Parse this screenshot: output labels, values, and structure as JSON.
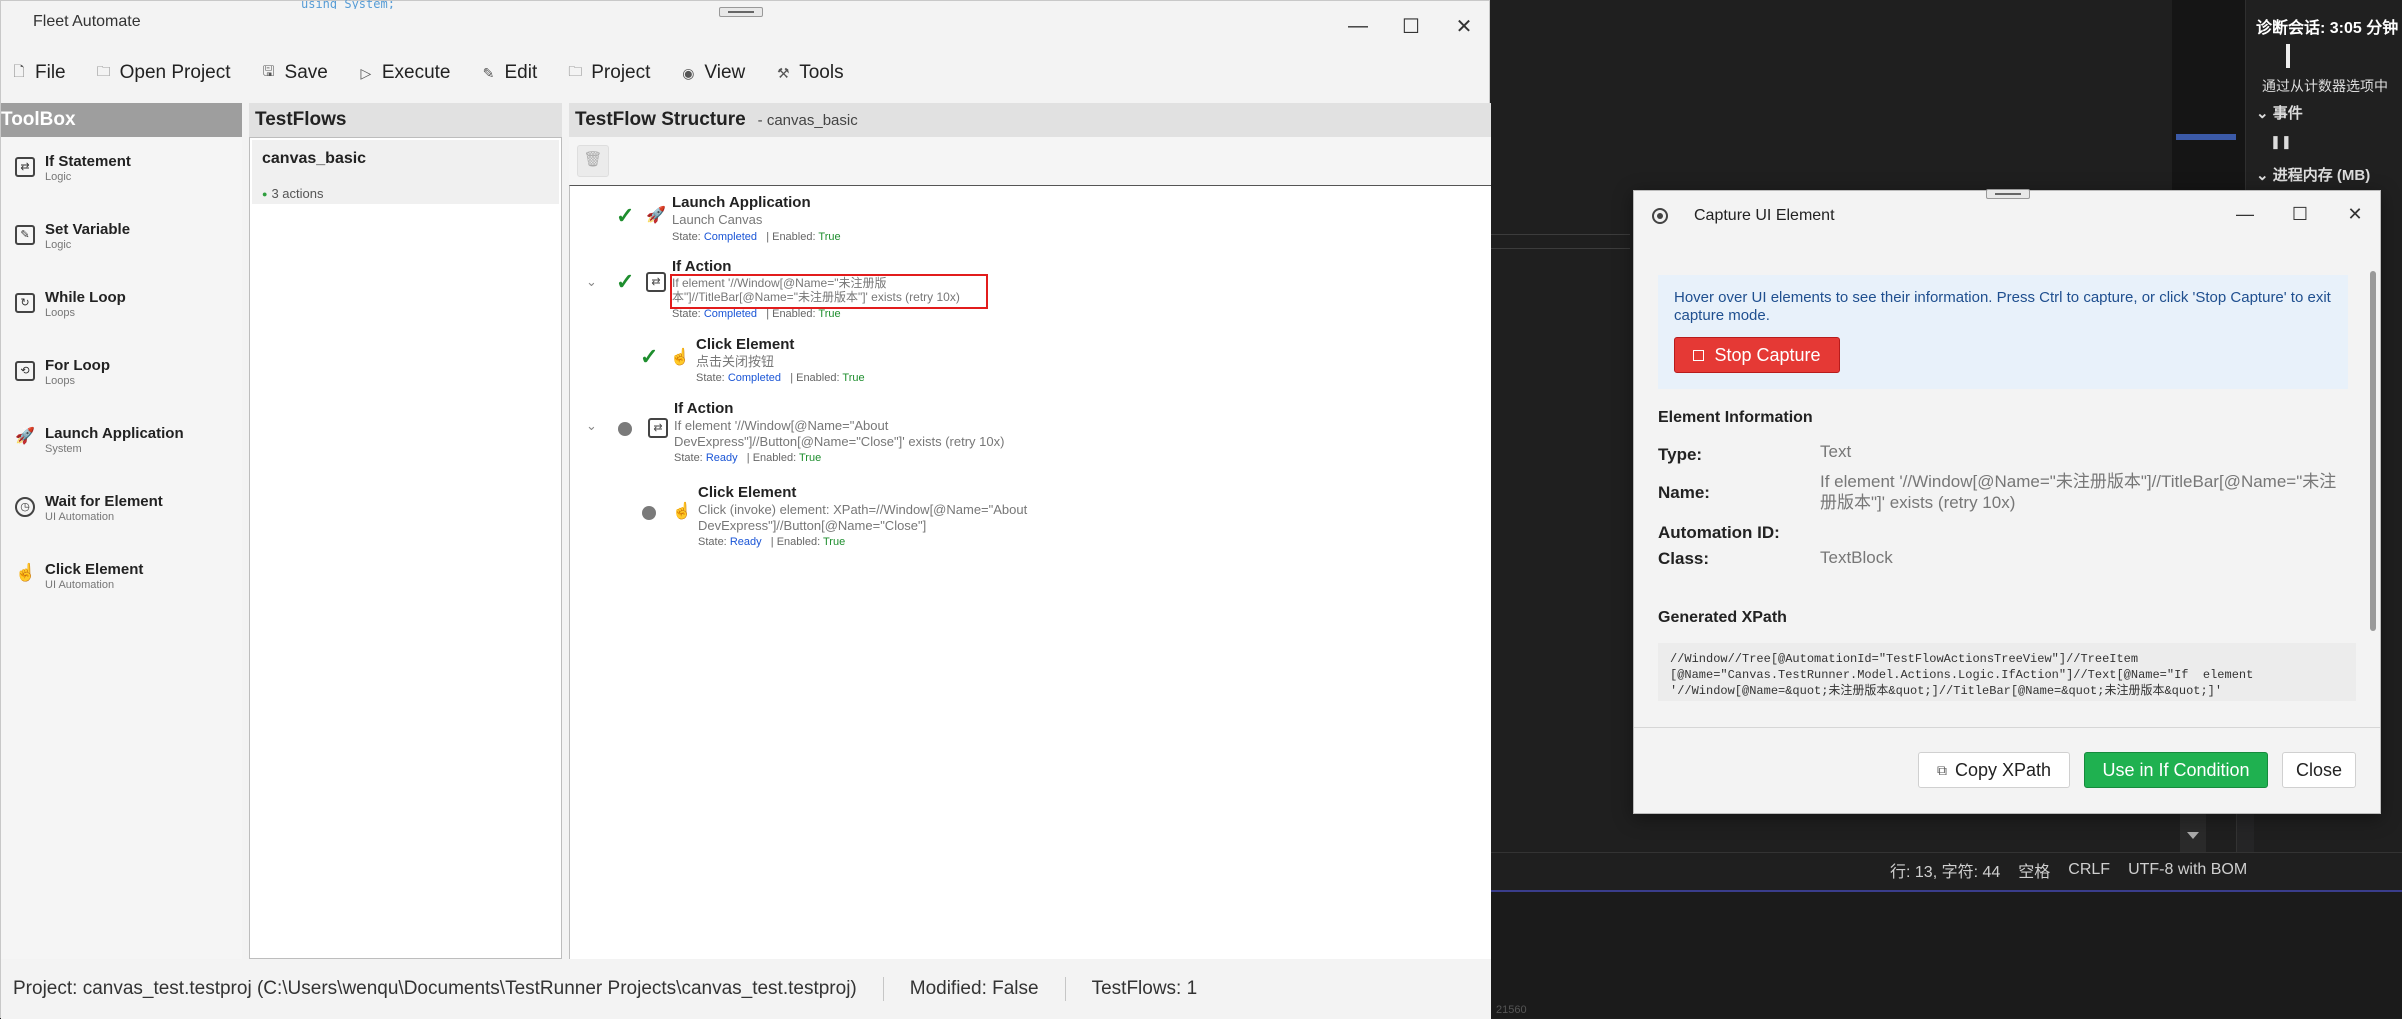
{
  "app": {
    "title": "Fleet Automate"
  },
  "background": {
    "code_snippet": "using System;",
    "editor_status": [
      "行: 13, 字符: 44",
      "空格",
      "CRLF",
      "UTF-8 with BOM"
    ],
    "diag": {
      "title": "诊断会话: 3:05 分钟",
      "hint": "通过从计数器选项中",
      "events_label": "事件",
      "memory_label": "进程内存 (MB)"
    },
    "faint_text": "21560"
  },
  "menu": [
    {
      "label": "File",
      "icon": "file-icon"
    },
    {
      "label": "Open Project",
      "icon": "folder-icon"
    },
    {
      "label": "Save",
      "icon": "save-icon"
    },
    {
      "label": "Execute",
      "icon": "play-icon"
    },
    {
      "label": "Edit",
      "icon": "edit-icon"
    },
    {
      "label": "Project",
      "icon": "project-icon"
    },
    {
      "label": "View",
      "icon": "eye-icon"
    },
    {
      "label": "Tools",
      "icon": "wrench-icon"
    }
  ],
  "toolbox": {
    "header": "ToolBox",
    "items": [
      {
        "name": "If Statement",
        "category": "Logic",
        "icon": "shuffle-icon"
      },
      {
        "name": "Set Variable",
        "category": "Logic",
        "icon": "edit-icon"
      },
      {
        "name": "While Loop",
        "category": "Loops",
        "icon": "loop-icon"
      },
      {
        "name": "For Loop",
        "category": "Loops",
        "icon": "repeat-icon"
      },
      {
        "name": "Launch Application",
        "category": "System",
        "icon": "rocket-icon"
      },
      {
        "name": "Wait for Element",
        "category": "UI Automation",
        "icon": "timer-icon"
      },
      {
        "name": "Click Element",
        "category": "UI Automation",
        "icon": "hand-pointer-icon"
      }
    ]
  },
  "testflows": {
    "header": "TestFlows",
    "items": [
      {
        "name": "canvas_basic",
        "count": "3 actions"
      }
    ]
  },
  "structure": {
    "header": "TestFlow Structure",
    "subtitle": "- canvas_basic",
    "state_label": "State:",
    "enabled_label": "| Enabled:",
    "nodes": [
      {
        "title": "Launch Application",
        "desc": "Launch Canvas",
        "state": "Completed",
        "enabled": "True"
      },
      {
        "title": "If Action",
        "desc": "If element '//Window[@Name=\"未注册版本\"]//TitleBar[@Name=\"未注册版本\"]' exists (retry 10x)",
        "state": "Completed",
        "enabled": "True"
      },
      {
        "title": "Click Element",
        "desc": "点击关闭按钮",
        "state": "Completed",
        "enabled": "True"
      },
      {
        "title": "If Action",
        "desc": "If element '//Window[@Name=\"About DevExpress\"]//Button[@Name=\"Close\"]' exists (retry 10x)",
        "state": "Ready",
        "enabled": "True"
      },
      {
        "title": "Click Element",
        "desc": "Click (invoke) element: XPath=//Window[@Name=\"About DevExpress\"]//Button[@Name=\"Close\"]",
        "state": "Ready",
        "enabled": "True"
      }
    ]
  },
  "statusbar": {
    "project": "Project: canvas_test.testproj (C:\\Users\\wenqu\\Documents\\TestRunner Projects\\canvas_test.testproj)",
    "modified": "Modified: False",
    "testflows": "TestFlows: 1"
  },
  "capture_dialog": {
    "title": "Capture UI Element",
    "info": "Hover over UI elements to see their information. Press Ctrl to capture, or click 'Stop Capture' to exit capture mode.",
    "stop_button": "Stop Capture",
    "element_info_title": "Element Information",
    "fields": {
      "type_label": "Type:",
      "type_value": "Text",
      "name_label": "Name:",
      "name_value": "If element '//Window[@Name=\"未注册版本\"]//TitleBar[@Name=\"未注册版本\"]' exists (retry 10x)",
      "automation_id_label": "Automation ID:",
      "automation_id_value": "",
      "class_label": "Class:",
      "class_value": "TextBlock"
    },
    "xpath_title": "Generated XPath",
    "xpath": "//Window//Tree[@AutomationId=\"TestFlowActionsTreeView\"]//TreeItem\n[@Name=\"Canvas.TestRunner.Model.Actions.Logic.IfAction\"]//Text[@Name=\"If  element\n'//Window[@Name=&quot;未注册版本&quot;]//TitleBar[@Name=&quot;未注册版本&quot;]'",
    "buttons": {
      "copy": "Copy XPath",
      "use": "Use in If Condition",
      "close": "Close"
    }
  },
  "colors": {
    "accent_green": "#1fb150",
    "stop_red": "#e53935",
    "completed_blue": "#1a55d6",
    "check_green": "#1e8e2e"
  }
}
